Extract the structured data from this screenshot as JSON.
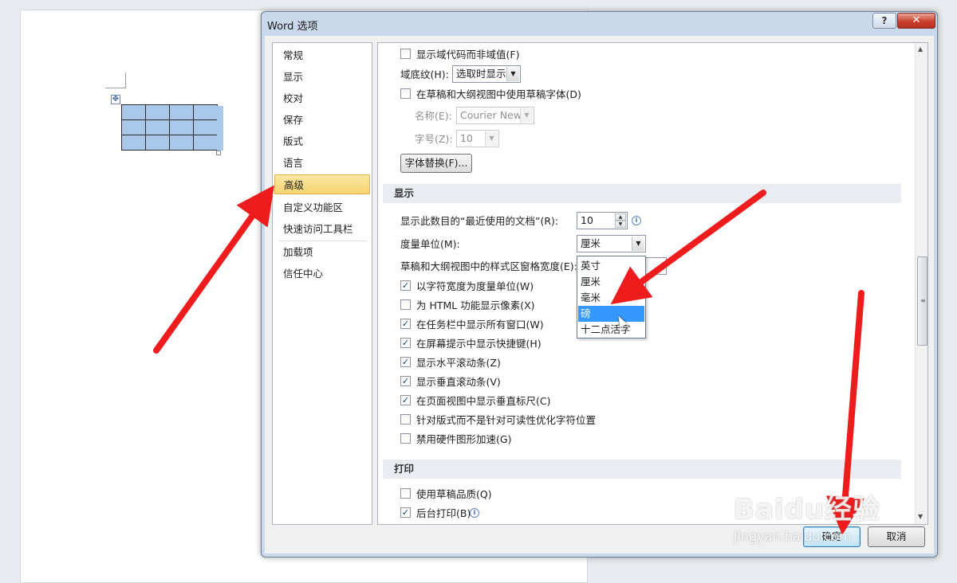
{
  "dialog": {
    "title": "Word 选项",
    "help_label": "?",
    "close_label": "✕"
  },
  "nav": {
    "items": [
      {
        "label": "常规"
      },
      {
        "label": "显示"
      },
      {
        "label": "校对"
      },
      {
        "label": "保存"
      },
      {
        "label": "版式"
      },
      {
        "label": "语言"
      },
      {
        "label": "高级",
        "selected": true
      },
      {
        "label": "自定义功能区"
      },
      {
        "label": "快速访问工具栏"
      },
      {
        "label": "加载项"
      },
      {
        "label": "信任中心"
      }
    ]
  },
  "advanced": {
    "field_codes": {
      "label": "显示域代码而非域值(F)",
      "checked": false
    },
    "field_shading": {
      "label": "域底纹(H):",
      "value": "选取时显示"
    },
    "draft_font": {
      "label": "在草稿和大纲视图中使用草稿字体(D)",
      "checked": false
    },
    "font_name": {
      "label": "名称(E):",
      "value": "Courier New"
    },
    "font_size": {
      "label": "字号(Z):",
      "value": "10"
    },
    "font_subst_button": "字体替换(F)...",
    "display_section": "显示",
    "recent_docs": {
      "label": "显示此数目的“最近使用的文档”(R):",
      "value": "10"
    },
    "measure_unit": {
      "label": "度量单位(M):",
      "value": "厘米"
    },
    "style_pane_width": {
      "label": "草稿和大纲视图中的样式区窗格宽度(E):"
    },
    "checkboxes": [
      {
        "label": "以字符宽度为度量单位(W)",
        "checked": true
      },
      {
        "label": "为 HTML 功能显示像素(X)",
        "checked": false
      },
      {
        "label": "在任务栏中显示所有窗口(W)",
        "checked": true
      },
      {
        "label": "在屏幕提示中显示快捷键(H)",
        "checked": true
      },
      {
        "label": "显示水平滚动条(Z)",
        "checked": true
      },
      {
        "label": "显示垂直滚动条(V)",
        "checked": true
      },
      {
        "label": "在页面视图中显示垂直标尺(C)",
        "checked": true
      },
      {
        "label": "针对版式而不是针对可读性优化字符位置",
        "checked": false
      },
      {
        "label": "禁用硬件图形加速(G)",
        "checked": false
      }
    ],
    "print_section": "打印",
    "print_checkboxes": [
      {
        "label": "使用草稿品质(Q)",
        "checked": false
      },
      {
        "label": "后台打印(B)",
        "checked": true
      }
    ]
  },
  "unit_dropdown": {
    "options": [
      "英寸",
      "厘米",
      "毫米",
      "磅",
      "十二点活字"
    ],
    "highlighted": "磅"
  },
  "footer": {
    "ok_label": "确定",
    "cancel_label": "取消"
  },
  "watermark": {
    "main": "Baidu经验",
    "sub": "jingyan.baidu.com"
  },
  "colors": {
    "nav_selected": "#f7d36f",
    "dropdown_highlight": "#3399ff",
    "annotation_arrow": "#ee1c1c"
  }
}
